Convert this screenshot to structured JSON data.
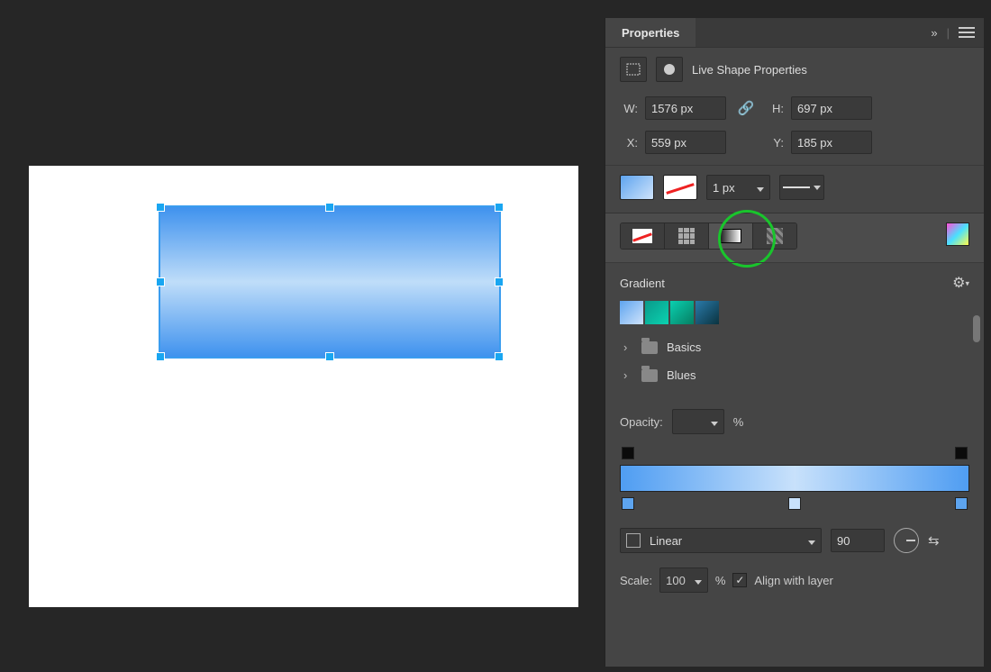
{
  "panel": {
    "title": "Properties",
    "section_title": "Live Shape Properties"
  },
  "dims": {
    "w_label": "W:",
    "w_value": "1576 px",
    "h_label": "H:",
    "h_value": "697 px",
    "x_label": "X:",
    "x_value": "559 px",
    "y_label": "Y:",
    "y_value": "185 px"
  },
  "stroke": {
    "width_value": "1 px"
  },
  "gradient": {
    "title": "Gradient",
    "folders": [
      "Basics",
      "Blues"
    ],
    "opacity_label": "Opacity:",
    "opacity_unit": "%",
    "type_label": "Linear",
    "angle_value": "90",
    "scale_label": "Scale:",
    "scale_value": "100",
    "scale_unit": "%",
    "align_label": "Align with layer"
  }
}
